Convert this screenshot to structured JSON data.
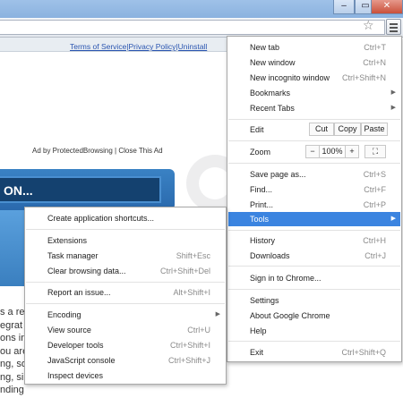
{
  "window": {
    "minimize_label": "–",
    "maximize_label": "▭",
    "close_label": "✕",
    "bookmark_icon": "star-icon",
    "menu_icon": "hamburger-menu-icon"
  },
  "page": {
    "policy_links": "Terms of Service|Privacy Policy|Uninstall",
    "ad_line": "Ad by ProtectedBrowsing | Close This Ad",
    "banner_text": "ON...",
    "body_lines": [
      "s a re",
      "egrat",
      "ons in",
      "ou are",
      "ng, so",
      "ng, si",
      "nding"
    ]
  },
  "chrome_menu": {
    "new_tab": {
      "label": "New tab",
      "shortcut": "Ctrl+T"
    },
    "new_window": {
      "label": "New window",
      "shortcut": "Ctrl+N"
    },
    "new_incognito": {
      "label": "New incognito window",
      "shortcut": "Ctrl+Shift+N"
    },
    "bookmarks": {
      "label": "Bookmarks"
    },
    "recent_tabs": {
      "label": "Recent Tabs"
    },
    "edit": {
      "label": "Edit",
      "cut": "Cut",
      "copy": "Copy",
      "paste": "Paste"
    },
    "zoom": {
      "label": "Zoom",
      "minus": "−",
      "value": "100%",
      "plus": "+",
      "fullscreen": "⛶"
    },
    "save_page": {
      "label": "Save page as...",
      "shortcut": "Ctrl+S"
    },
    "find": {
      "label": "Find...",
      "shortcut": "Ctrl+F"
    },
    "print": {
      "label": "Print...",
      "shortcut": "Ctrl+P"
    },
    "tools": {
      "label": "Tools"
    },
    "history": {
      "label": "History",
      "shortcut": "Ctrl+H"
    },
    "downloads": {
      "label": "Downloads",
      "shortcut": "Ctrl+J"
    },
    "sign_in": {
      "label": "Sign in to Chrome..."
    },
    "settings": {
      "label": "Settings"
    },
    "about": {
      "label": "About Google Chrome"
    },
    "help": {
      "label": "Help"
    },
    "exit": {
      "label": "Exit",
      "shortcut": "Ctrl+Shift+Q"
    }
  },
  "tools_menu": {
    "create_shortcuts": {
      "label": "Create application shortcuts..."
    },
    "extensions": {
      "label": "Extensions"
    },
    "task_manager": {
      "label": "Task manager",
      "shortcut": "Shift+Esc"
    },
    "clear_browsing": {
      "label": "Clear browsing data...",
      "shortcut": "Ctrl+Shift+Del"
    },
    "report_issue": {
      "label": "Report an issue...",
      "shortcut": "Alt+Shift+I"
    },
    "encoding": {
      "label": "Encoding"
    },
    "view_source": {
      "label": "View source",
      "shortcut": "Ctrl+U"
    },
    "developer_tools": {
      "label": "Developer tools",
      "shortcut": "Ctrl+Shift+I"
    },
    "javascript_console": {
      "label": "JavaScript console",
      "shortcut": "Ctrl+Shift+J"
    },
    "inspect_devices": {
      "label": "Inspect devices"
    }
  },
  "colors": {
    "highlight": "#3b84e0",
    "banner_dark": "#14416f",
    "banner_light": "#3a82c4",
    "link": "#2a55b0"
  }
}
